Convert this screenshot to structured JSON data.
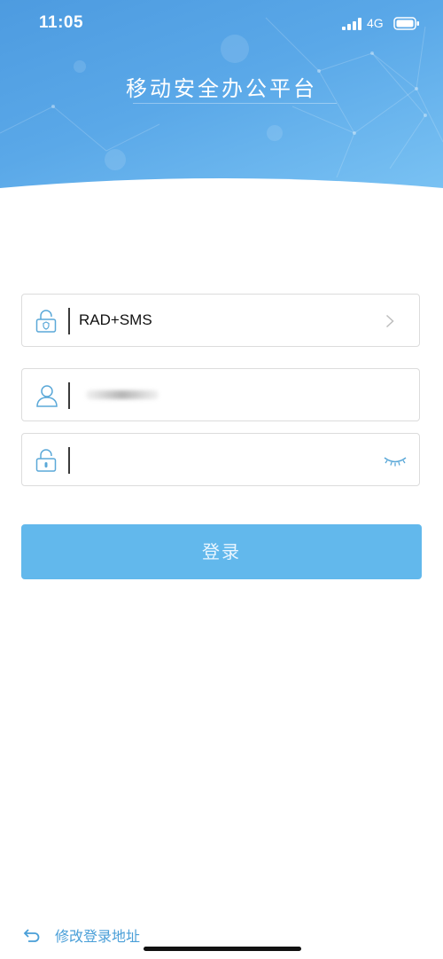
{
  "status_bar": {
    "time": "11:05",
    "network": "4G"
  },
  "header": {
    "title": "移动安全办公平台"
  },
  "form": {
    "auth_mode_value": "RAD+SMS",
    "username_value": "",
    "password_value": ""
  },
  "login_button_label": "登录",
  "footer": {
    "change_address_label": "修改登录地址"
  },
  "colors": {
    "header_gradient_start": "#4d9be0",
    "header_gradient_end": "#7cc4f4",
    "button": "#62b8ec",
    "link": "#4a9fd8",
    "icon": "#5aa8d8"
  },
  "icons": [
    "signal-icon",
    "battery-icon",
    "lock-icon",
    "user-icon",
    "chevron-right-icon",
    "eye-closed-icon",
    "return-arrow-icon"
  ]
}
